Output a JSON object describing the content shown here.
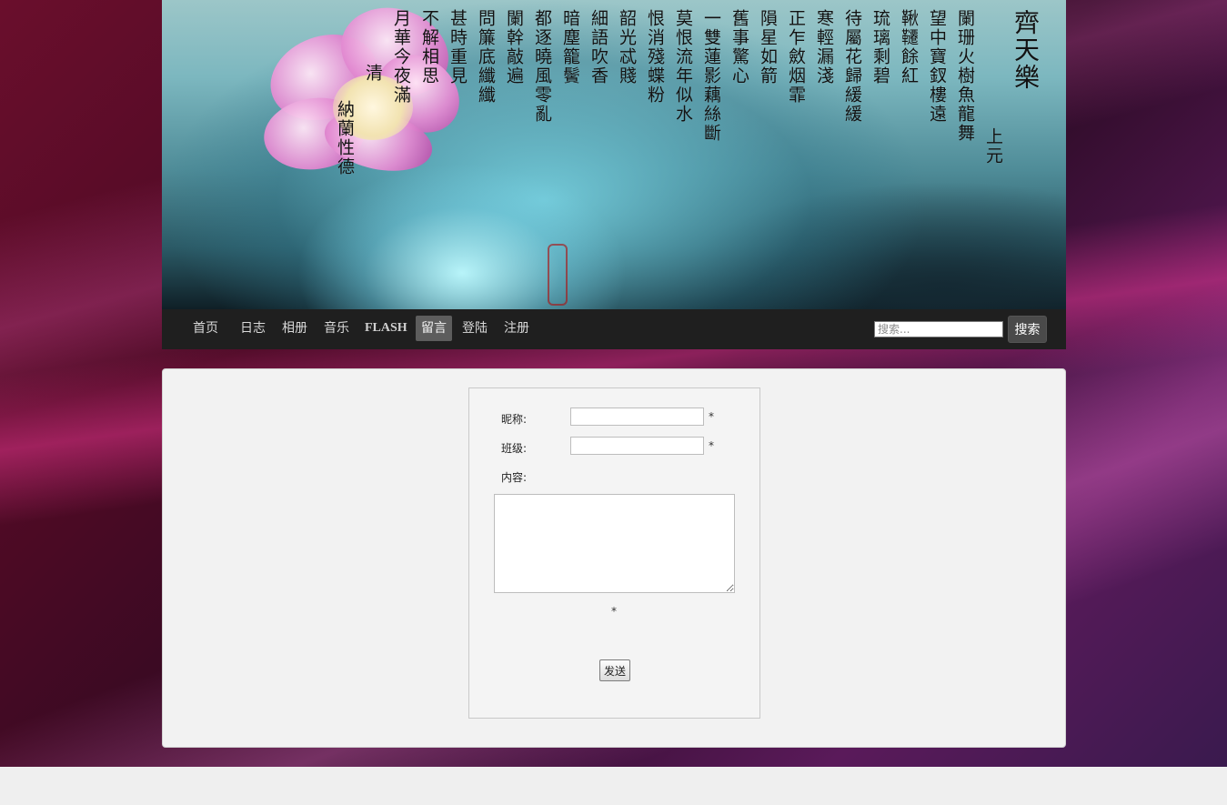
{
  "banner": {
    "poem_title": "齊天樂",
    "poem_subtitle": "上元",
    "poem_lines": [
      "闌珊火樹魚龍舞",
      "望中寶釵樓遠",
      "鞦韆餘紅",
      "琉璃剩碧",
      "待屬花歸緩緩",
      "寒輕漏淺",
      "正乍斂烟霏",
      "隕星如箭",
      "舊事驚心",
      "一雙蓮影藕絲斷",
      "莫恨流年似水",
      "恨消殘蝶粉",
      "韶光忒賤",
      "細語吹香",
      "暗塵籠鬢",
      "都逐曉風零亂",
      "闌幹敲遍",
      "問簾底纖纖",
      "甚時重見",
      "不解相思",
      "月華今夜滿"
    ],
    "author_dynasty": "清",
    "author_name": "納蘭性德"
  },
  "nav": {
    "items": [
      {
        "label": "首页"
      },
      {
        "label": "日志"
      },
      {
        "label": "相册"
      },
      {
        "label": "音乐"
      },
      {
        "label": "FLASH"
      },
      {
        "label": "留言",
        "active": true
      },
      {
        "label": "登陆"
      },
      {
        "label": "注册"
      }
    ],
    "search": {
      "placeholder": "搜索...",
      "button_label": "搜索"
    }
  },
  "form": {
    "nickname_label": "昵称:",
    "class_label": "班级:",
    "content_label": "内容:",
    "required_mark": "*",
    "submit_label": "发送"
  }
}
